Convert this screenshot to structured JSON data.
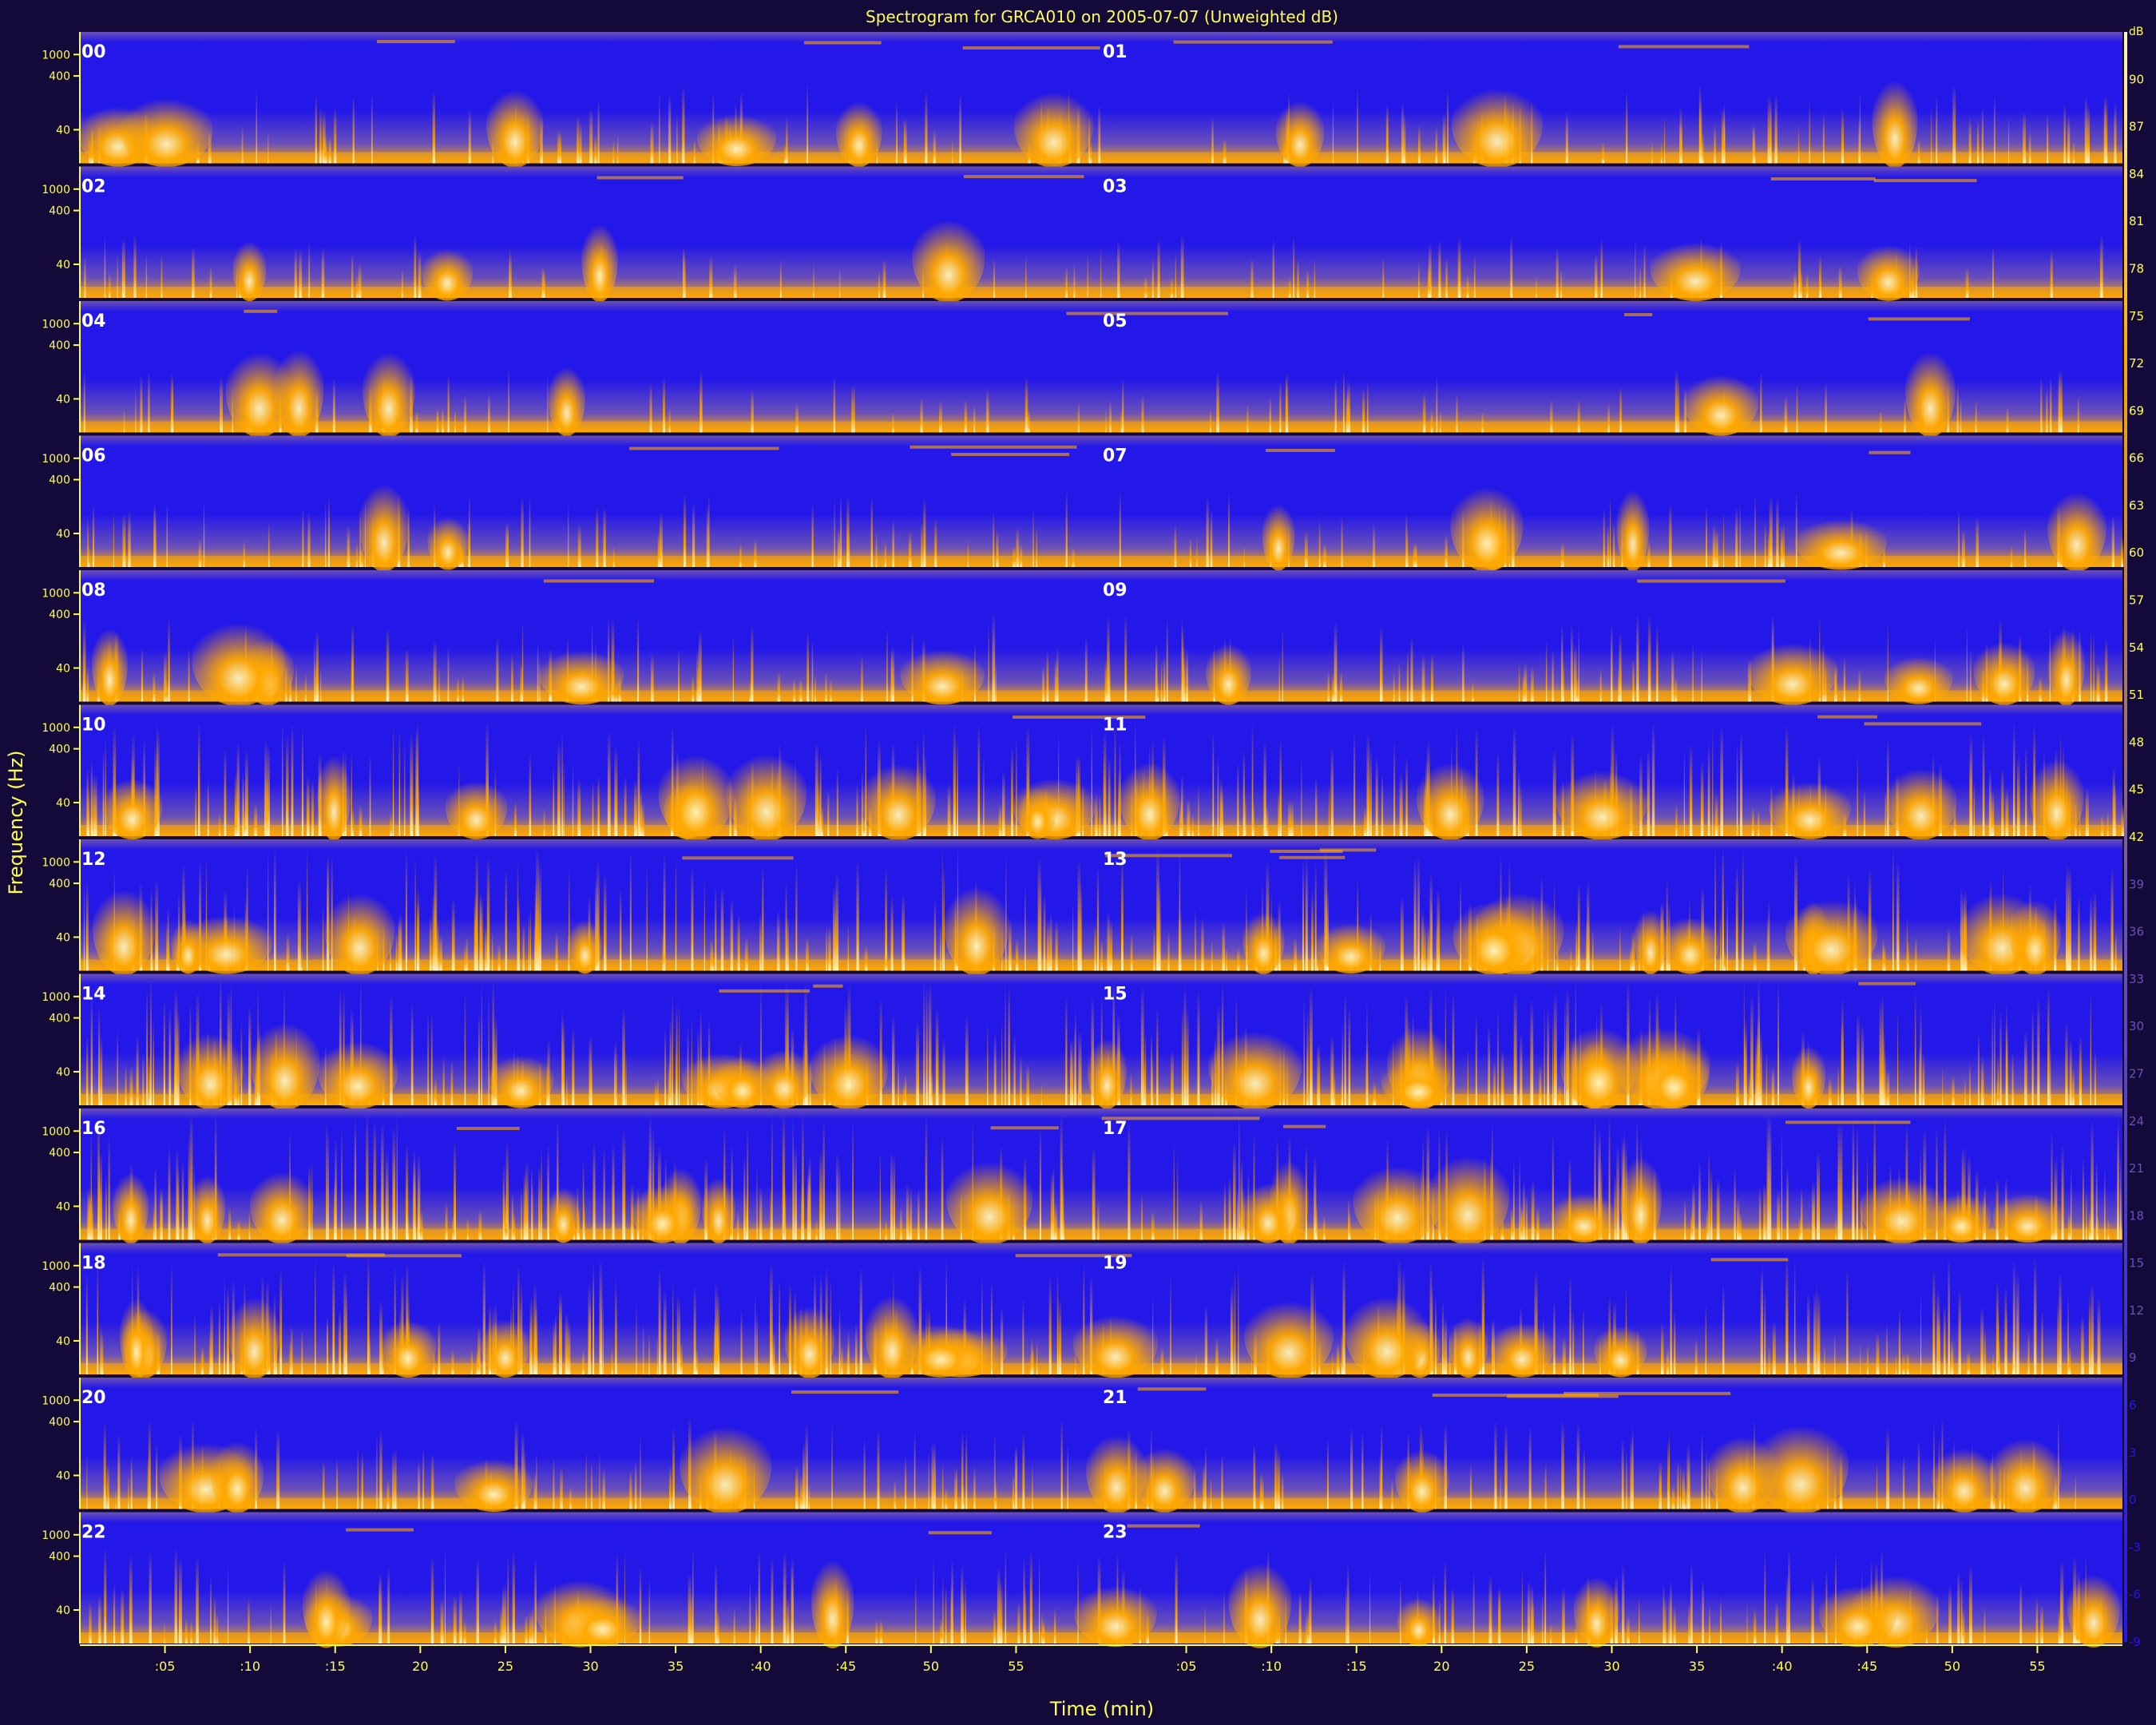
{
  "chart_data": {
    "type": "heatmap",
    "title": "Spectrogram for GRCA010 on 2005-07-07 (Unweighted dB)",
    "xlabel": "Time (min)",
    "ylabel": "Frequency (Hz)",
    "xlim": [
      0,
      60
    ],
    "ylim": [
      12.5,
      2000
    ],
    "yscale": "log",
    "colorbar": {
      "label": "dB",
      "range": [
        -9,
        93
      ],
      "ticks": [
        90,
        87,
        84,
        81,
        78,
        75,
        72,
        69,
        66,
        63,
        60,
        57,
        54,
        51,
        48,
        45,
        42,
        39,
        36,
        33,
        30,
        27,
        24,
        21,
        18,
        15,
        12,
        9,
        6,
        3,
        0,
        -3,
        -6,
        -9
      ]
    },
    "ytick_labels": [
      "1000",
      "400",
      "40"
    ],
    "x_tick_labels": [
      ":05",
      ":10",
      ":15",
      "20",
      "25",
      "30",
      "35",
      ":40",
      ":45",
      "50",
      "55",
      ":05",
      ":10",
      ":15",
      "20",
      "25",
      "30",
      "35",
      ":40",
      ":45",
      "50",
      "55"
    ],
    "hour_labels": [
      "00",
      "01",
      "02",
      "03",
      "04",
      "05",
      "06",
      "07",
      "08",
      "09",
      "10",
      "11",
      "12",
      "13",
      "14",
      "15",
      "16",
      "17",
      "18",
      "19",
      "20",
      "21",
      "22",
      "23"
    ],
    "colors": {
      "background": "#140a3a",
      "low": "#2418e8",
      "mid": "#6a50b8",
      "high": "#ffa800",
      "peak": "#fff4c0",
      "text": "#ffff50",
      "label": "#ffffff"
    }
  }
}
